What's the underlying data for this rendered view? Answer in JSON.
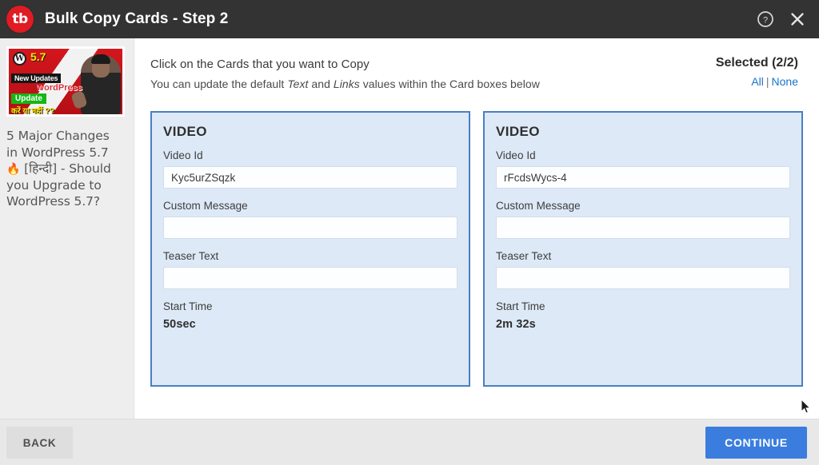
{
  "titlebar": {
    "logo_text": "tb",
    "title": "Bulk Copy Cards - Step 2",
    "help_icon": "help-circle-icon",
    "close_icon": "close-icon"
  },
  "sidebar": {
    "thumbnail": {
      "wp_badge": "W",
      "version": "5.7",
      "tag_new_updates": "New Updates",
      "tag_wordpress": "WordPress",
      "tag_update": "Update",
      "tag_question": "करें या नहीं ??"
    },
    "video_title_line1": "5 Major Changes in WordPress 5.7 ",
    "fire_emoji": "🔥",
    "video_title_line2": " [हिन्दी] - Should you Upgrade to WordPress 5.7?"
  },
  "main": {
    "instruction_primary": "Click on the Cards that you want to Copy",
    "instruction_secondary_part1": "You can update the default ",
    "instruction_secondary_em1": "Text",
    "instruction_secondary_part2": " and ",
    "instruction_secondary_em2": "Links",
    "instruction_secondary_part3": " values within the Card boxes below",
    "selected_label": "Selected (2/2)",
    "select_all_label": "All",
    "select_separator": "|",
    "select_none_label": "None"
  },
  "cards": [
    {
      "type": "VIDEO",
      "video_id_label": "Video Id",
      "video_id_value": "Kyc5urZSqzk",
      "custom_message_label": "Custom Message",
      "custom_message_value": "",
      "teaser_text_label": "Teaser Text",
      "teaser_text_value": "",
      "start_time_label": "Start Time",
      "start_time_value": "50sec",
      "selected": true
    },
    {
      "type": "VIDEO",
      "video_id_label": "Video Id",
      "video_id_value": "rFcdsWycs-4",
      "custom_message_label": "Custom Message",
      "custom_message_value": "",
      "teaser_text_label": "Teaser Text",
      "teaser_text_value": "",
      "start_time_label": "Start Time",
      "start_time_value": "2m 32s",
      "selected": true
    }
  ],
  "footer": {
    "back_label": "BACK",
    "continue_label": "CONTINUE"
  },
  "colors": {
    "titlebar_bg": "#333333",
    "logo_red": "#e01b22",
    "card_border": "#4a7fc0",
    "card_bg": "#dde9f7",
    "link_blue": "#1a73c8",
    "continue_blue": "#3b7dde",
    "sidebar_bg": "#eeeeee"
  }
}
